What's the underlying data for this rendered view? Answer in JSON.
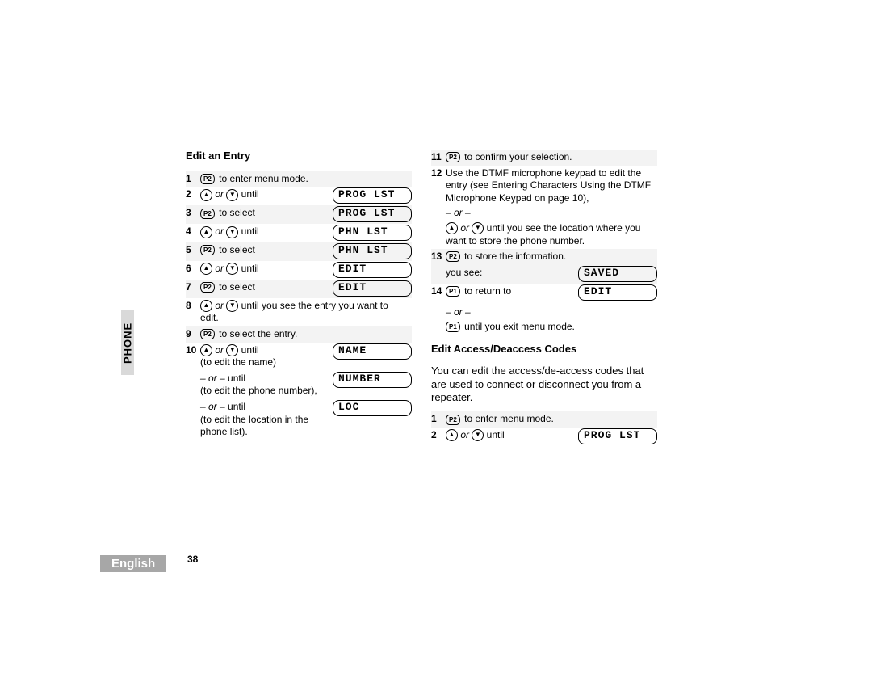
{
  "side_tab_vert": "PHONE",
  "side_tab_horiz": "English",
  "page_number": "38",
  "btn": {
    "P2": "P2",
    "P1": "P1",
    "up": "▲",
    "down": "▼"
  },
  "left": {
    "title": "Edit an Entry",
    "s1": " to enter menu mode.",
    "s2_or": " or ",
    "s2_until": " until",
    "d2": "PROG LST",
    "s3": " to select",
    "d3": "PROG LST",
    "s4_or": " or ",
    "s4_until": " until",
    "d4": "PHN LST",
    "s5": " to select",
    "d5": "PHN LST",
    "s6_or": " or ",
    "s6_until": " until",
    "d6": "EDIT",
    "s7": " to select",
    "d7": "EDIT",
    "s8_or": " or ",
    "s8_text": " until you see the entry you want to edit.",
    "s9": " to select the entry.",
    "s10_or": " or ",
    "s10_until": " until",
    "s10_a": "(to edit the name)",
    "d10a": "NAME",
    "s10b_prefix": "– or –",
    "s10b_until": " until",
    "s10_b": "(to edit the phone number),",
    "d10b": "NUMBER",
    "s10c_prefix": "– or –",
    "s10c_until": " until",
    "s10_c": "(to edit the location in the phone list).",
    "d10c": "LOC"
  },
  "right": {
    "s11": " to confirm your selection.",
    "s12": "Use the DTMF microphone keypad to edit the entry (see Entering Characters Using the DTMF Microphone Keypad on page 10),",
    "s12_or": "– or –",
    "s12_b_or": " or ",
    "s12_b": " until you see the location where you want to store the phone number.",
    "s13": " to store the information.",
    "s13_you": "you see:",
    "d13": "SAVED",
    "s14": " to return to",
    "d14": "EDIT",
    "s14_or": "– or –",
    "s14_b": " until you exit menu mode.",
    "title2": "Edit Access/Deaccess Codes",
    "body": "You can edit the access/de-access codes that are used to connect or disconnect you from a repeater.",
    "r1": " to enter menu mode.",
    "r2_or": " or ",
    "r2_until": " until",
    "dr2": "PROG LST"
  }
}
